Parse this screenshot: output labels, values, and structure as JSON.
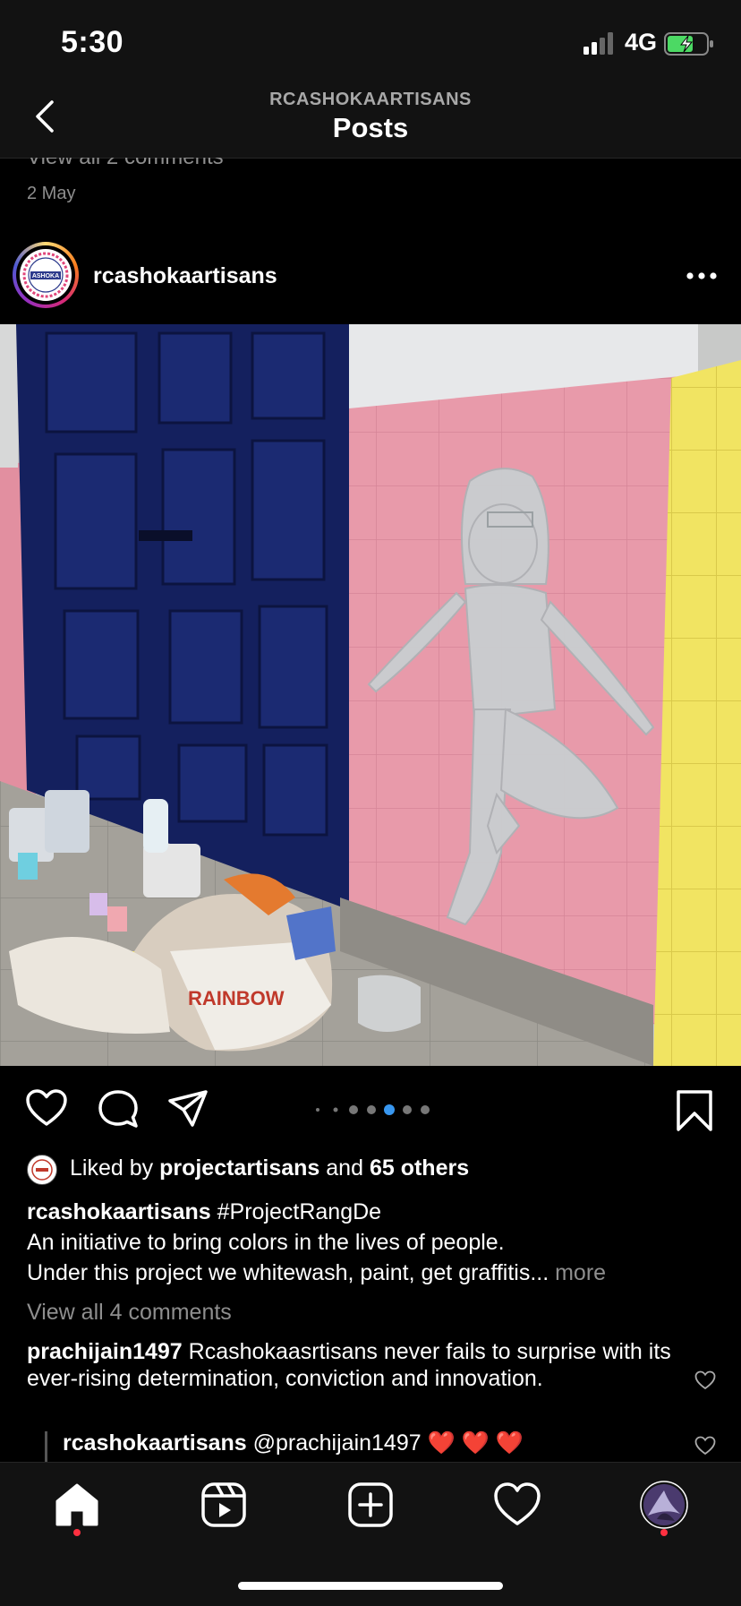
{
  "status_bar": {
    "time": "5:30",
    "network": "4G",
    "battery_charging": true
  },
  "header": {
    "subtitle": "RCASHOKAARTISANS",
    "title": "Posts"
  },
  "previous_post": {
    "comments_link": "View all 2 comments",
    "date": "2 May"
  },
  "post": {
    "username": "rcashokaartisans",
    "avatar_logo_text": "ASHOKA",
    "carousel": {
      "count": 7,
      "active_index": 4
    },
    "likes": {
      "prefix": "Liked by",
      "user": "projectartisans",
      "middle": "and",
      "others": "65 others"
    },
    "caption": {
      "user": "rcashokaartisans",
      "hashtag": "#ProjectRangDe",
      "line1": "An initiative to bring colors in the lives of people.",
      "line2": "Under this project we whitewash, paint, get graffitis...",
      "more": "more"
    },
    "view_all_comments": "View all 4 comments",
    "comments": [
      {
        "user": "prachijain1497",
        "text": "Rcashokaasrtisans never fails to surprise with its ever-rising determination, conviction and innovation."
      },
      {
        "user": "rcashokaartisans",
        "text": "@prachijain1497 ❤️ ❤️ ❤️"
      }
    ]
  },
  "icons": {
    "back": "chevron-left-icon",
    "more": "more-horizontal-icon",
    "like": "heart-icon",
    "comment": "comment-bubble-icon",
    "share": "paper-plane-icon",
    "save": "bookmark-icon",
    "tabs": [
      "home-icon",
      "reels-icon",
      "create-post-icon",
      "activity-heart-icon",
      "profile-avatar-icon"
    ]
  },
  "colors": {
    "accent_blue": "#3897f0",
    "notification_red": "#ff3040",
    "background": "#000000"
  }
}
